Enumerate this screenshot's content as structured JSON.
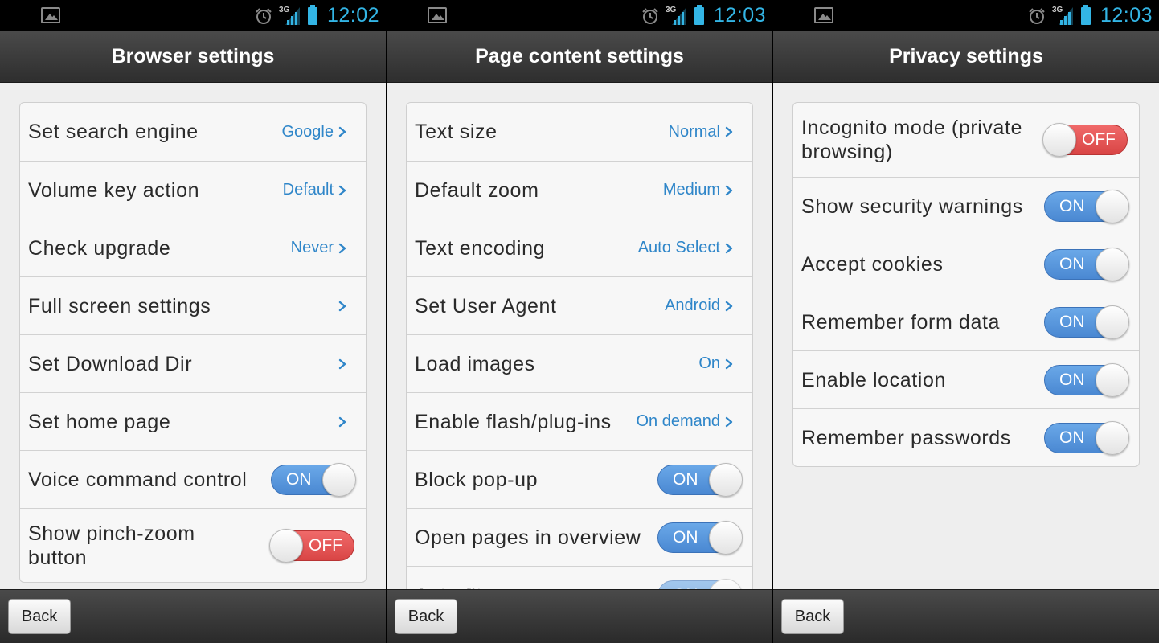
{
  "colors": {
    "accent": "#33b5e5",
    "link": "#2f86c9",
    "toggle_on": "#4a88d2",
    "toggle_off": "#d94545"
  },
  "screens": [
    {
      "status": {
        "time": "12:02",
        "network": "3G"
      },
      "title": "Browser settings",
      "rows": [
        {
          "label": "Set search engine",
          "value": "Google"
        },
        {
          "label": "Volume key action",
          "value": "Default"
        },
        {
          "label": "Check upgrade",
          "value": "Never"
        },
        {
          "label": "Full screen settings"
        },
        {
          "label": "Set Download Dir"
        },
        {
          "label": "Set home page"
        },
        {
          "label": "Voice command control",
          "toggle": "ON"
        },
        {
          "label": "Show pinch-zoom\nbutton",
          "toggle": "OFF"
        }
      ],
      "back_label": "Back"
    },
    {
      "status": {
        "time": "12:03",
        "network": "3G"
      },
      "title": "Page content settings",
      "rows": [
        {
          "label": "Text size",
          "value": "Normal"
        },
        {
          "label": "Default zoom",
          "value": "Medium"
        },
        {
          "label": "Text encoding",
          "value": "Auto Select"
        },
        {
          "label": "Set User Agent",
          "value": "Android"
        },
        {
          "label": "Load images",
          "value": "On"
        },
        {
          "label": "Enable flash/plug-ins",
          "value": "On demand"
        },
        {
          "label": "Block pop-up",
          "toggle": "ON"
        },
        {
          "label": "Open pages in overview",
          "toggle": "ON"
        },
        {
          "label": "Auto-fit",
          "toggle": "ON"
        }
      ],
      "back_label": "Back"
    },
    {
      "status": {
        "time": "12:03",
        "network": "3G"
      },
      "title": "Privacy settings",
      "rows": [
        {
          "label": "Incognito mode (private\nbrowsing)",
          "toggle": "OFF"
        },
        {
          "label": "Show security warnings",
          "toggle": "ON"
        },
        {
          "label": "Accept cookies",
          "toggle": "ON"
        },
        {
          "label": "Remember form data",
          "toggle": "ON"
        },
        {
          "label": "Enable location",
          "toggle": "ON"
        },
        {
          "label": "Remember passwords",
          "toggle": "ON"
        }
      ],
      "back_label": "Back"
    }
  ]
}
